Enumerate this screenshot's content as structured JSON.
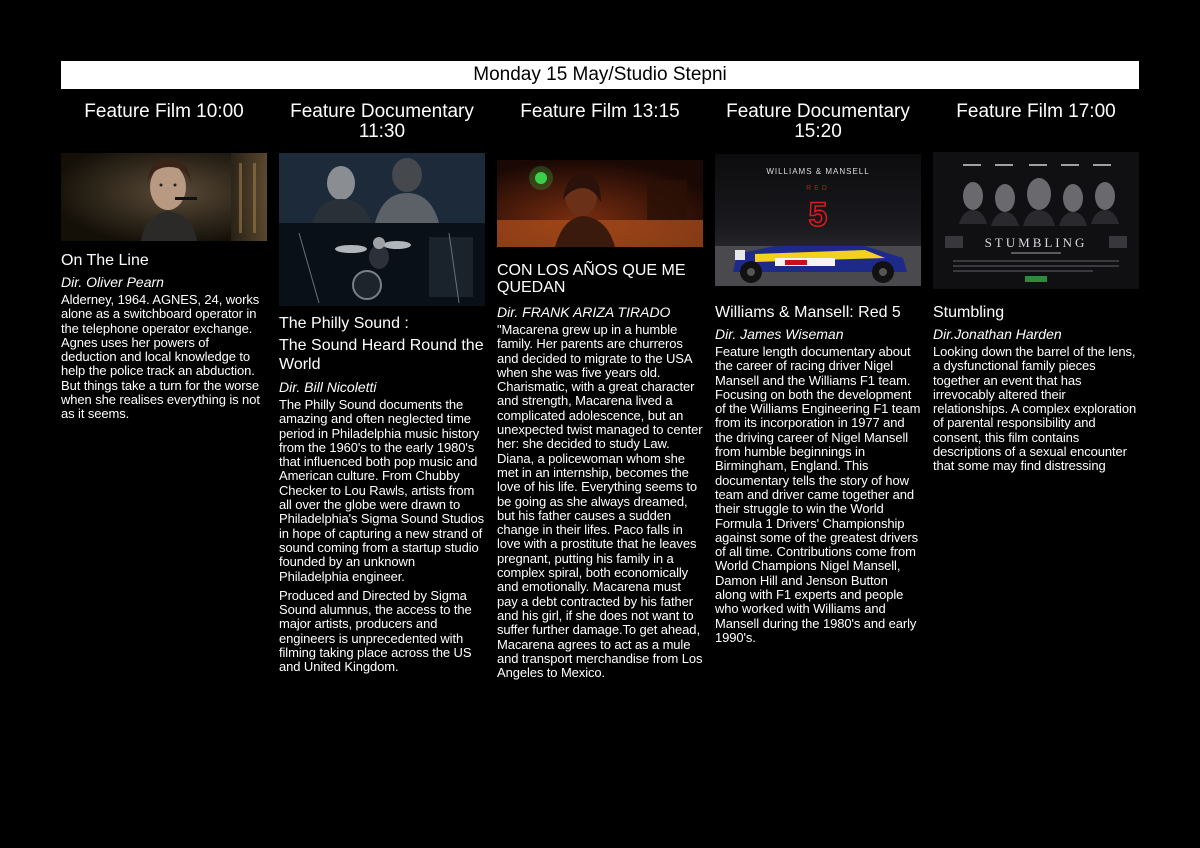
{
  "header": {
    "title": "Monday 15 May/Studio Stepni"
  },
  "films": [
    {
      "slot": "Feature Film 10:00",
      "title": "On The Line",
      "director": "Dir. Oliver Pearn",
      "description": "Alderney, 1964. AGNES, 24, works alone as a switchboard operator in the telephone operator exchange. Agnes uses her powers of deduction and local knowledge to help the police track an abduction. But things take a turn for the worse when she realises everything is not as it seems."
    },
    {
      "slot": "Feature Documentary 11:30",
      "title_line1": "The Philly Sound :",
      "title_line2": "The Sound Heard Round the World",
      "director": "Dir. Bill Nicoletti",
      "description": "The Philly Sound documents the amazing and often neglected time period in Philadelphia music history from the 1960's to the early 1980's that influenced both pop music and American culture. From Chubby Checker to Lou Rawls, artists from all over the globe were drawn to Philadelphia's Sigma Sound Studios in hope of capturing a new strand of sound coming from a startup studio founded by an unknown Philadelphia engineer.",
      "description_2": "Produced and Directed by Sigma Sound alumnus, the access to the major artists, producers and engineers is unprecedented with filming taking place across the US and United Kingdom."
    },
    {
      "slot": "Feature Film 13:15",
      "title": "CON LOS AÑOS QUE ME QUEDAN",
      "director": "Dir. FRANK ARIZA TIRADO",
      "description": "\"Macarena grew up in a humble family. Her parents are churreros and decided to migrate to the USA when she was five years old. Charismatic, with a great character and strength, Macarena lived a complicated adolescence, but an unexpected twist managed to center her: she decided to study Law. Diana, a policewoman whom she met in an internship, becomes the love of his life. Everything seems to be going as she always dreamed, but his father causes a sudden change in their lifes. Paco falls in love with a prostitute that he leaves pregnant, putting his family in a complex spiral, both economically and emotionally. Macarena must pay a debt contracted by his father and his girl, if she does not want to suffer further damage.To get ahead, Macarena agrees to act as a mule and transport merchandise from Los Angeles to Mexico."
    },
    {
      "slot": "Feature Documentary 15:20",
      "title": "Williams & Mansell: Red 5",
      "director": "Dir. James Wiseman",
      "description": "Feature length documentary about the career of racing driver Nigel Mansell and the Williams F1 team. Focusing on both the development of the Williams Engineering F1 team from its incorporation in 1977 and the driving career of Nigel Mansell from humble beginnings in Birmingham, England. This documentary tells the story of how team and driver came together and their struggle to win the World Formula 1 Drivers' Championship against some of the greatest drivers of all time. Contributions come from World Champions Nigel Mansell, Damon Hill and Jenson Button along with F1 experts and people who worked with Williams and Mansell during the 1980's and early 1990's.",
      "poster_text": {
        "top": "WILLIAMS & MANSELL",
        "red": "RED",
        "five": "5"
      }
    },
    {
      "slot": "Feature Film 17:00",
      "title": "Stumbling",
      "director": "Dir.Jonathan Harden",
      "description": "Looking down the barrel of the lens, a dysfunctional family pieces together an event that has irrevocably altered their relationships. A complex exploration of parental responsibility and consent, this film contains descriptions of a sexual encounter that some may find distressing",
      "poster_text": {
        "title": "STUMBLING"
      }
    }
  ]
}
